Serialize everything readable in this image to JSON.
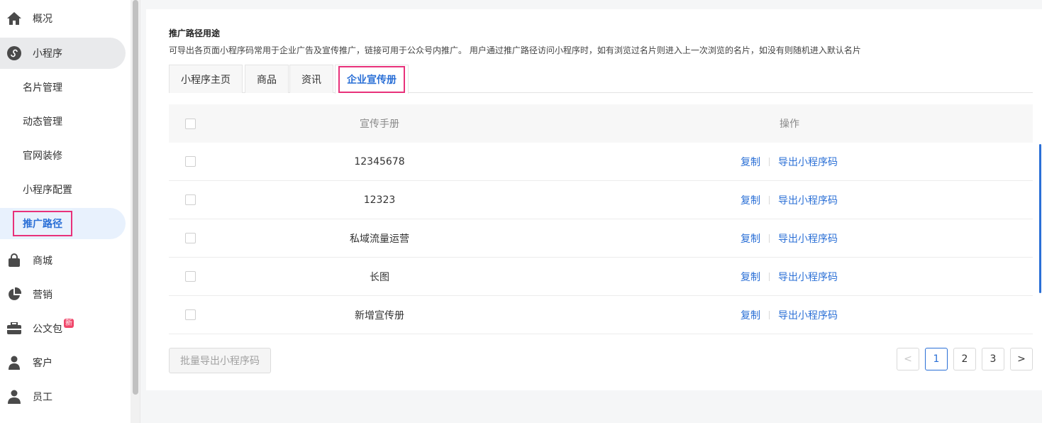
{
  "sidebar": {
    "items": [
      {
        "label": "概况",
        "icon": "home-icon"
      },
      {
        "label": "小程序",
        "icon": "mini-program-icon"
      },
      {
        "label": "名片管理"
      },
      {
        "label": "动态管理"
      },
      {
        "label": "官网装修"
      },
      {
        "label": "小程序配置"
      },
      {
        "label": "推广路径"
      },
      {
        "label": "商城",
        "icon": "shopping-bag-icon"
      },
      {
        "label": "营销",
        "icon": "pie-chart-icon"
      },
      {
        "label": "公文包",
        "icon": "briefcase-icon",
        "badge": "新"
      },
      {
        "label": "客户",
        "icon": "customer-icon"
      },
      {
        "label": "员工",
        "icon": "user-icon"
      }
    ]
  },
  "page": {
    "title": "推广路径用途",
    "description": "可导出各页面小程序码常用于企业广告及宣传推广，链接可用于公众号内推广。 用户通过推广路径访问小程序时，如有浏览过名片则进入上一次浏览的名片，如没有则随机进入默认名片"
  },
  "tabs": [
    {
      "label": "小程序主页"
    },
    {
      "label": "商品"
    },
    {
      "label": "资讯"
    },
    {
      "label": "企业宣传册"
    }
  ],
  "table": {
    "headers": {
      "name": "宣传手册",
      "op": "操作"
    },
    "rows": [
      {
        "name": "12345678"
      },
      {
        "name": "12323"
      },
      {
        "name": "私域流量运营"
      },
      {
        "name": "长图"
      },
      {
        "name": "新增宣传册"
      }
    ],
    "op_copy": "复制",
    "op_export": "导出小程序码"
  },
  "batch_button": "批量导出小程序码",
  "pagination": {
    "prev": "<",
    "pages": [
      "1",
      "2",
      "3"
    ],
    "next": ">",
    "current": "1"
  },
  "colors": {
    "accent": "#2a6fd6",
    "highlight": "#e8317a",
    "badge": "#f0476a"
  }
}
